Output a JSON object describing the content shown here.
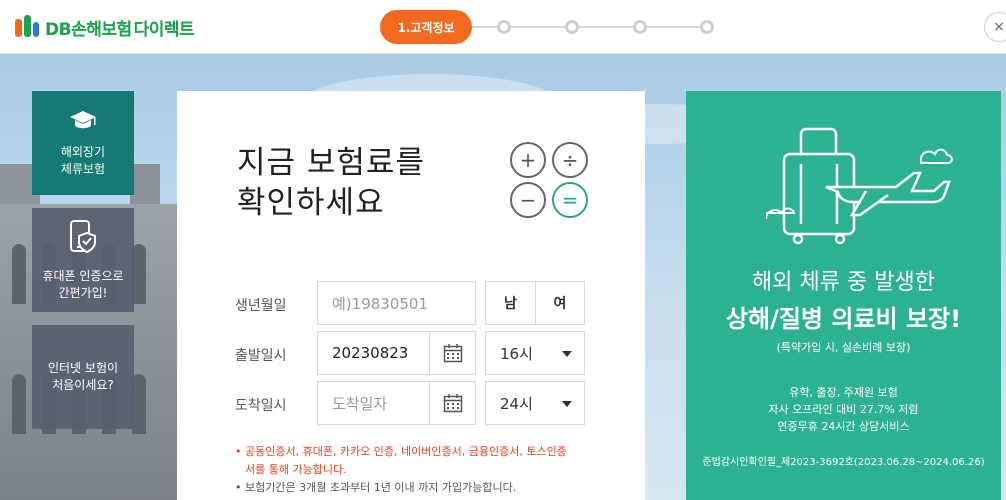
{
  "header": {
    "logo_text": "DB손해보험",
    "logo_sub": "다이렉트",
    "active_step": "1.고객정보",
    "close_label": "×"
  },
  "sidebar": {
    "items": [
      {
        "label_line1": "해외장기",
        "label_line2": "체류보험",
        "icon": "graduation-cap-icon"
      },
      {
        "label_line1": "휴대폰 인증으로",
        "label_line2": "간편가입!",
        "icon": "phone-shield-icon"
      },
      {
        "label_line1": "인터넷 보험이",
        "label_line2": "처음이세요?",
        "icon": "none"
      }
    ]
  },
  "form": {
    "title_line1": "지금 보험료를",
    "title_line2": "확인하세요",
    "calc_symbols": [
      "+",
      "÷",
      "−",
      "="
    ],
    "birth": {
      "label": "생년월일",
      "placeholder": "예)19830501",
      "gender_male": "남",
      "gender_female": "여"
    },
    "departure": {
      "label": "출발일시",
      "date_value": "20230823",
      "hour_value": "16시"
    },
    "arrival": {
      "label": "도착일시",
      "date_placeholder": "도착일자",
      "hour_value": "24시"
    },
    "notices": {
      "red_line1": "• 공동인증서, 휴대폰, 카카오 인증, 네이버인증서, 금융인증서, 토스인증",
      "red_line2": "서를 통해 가능합니다.",
      "gray_line": "• 보험기간은 3개월 초과부터 1년 이내 까지 가입가능합니다."
    }
  },
  "promo": {
    "head1": "해외 체류 중 발생한",
    "head2": "상해/질병 의료비 보장!",
    "sub": "(특약가입 시, 실손비례 보장)",
    "line1": "유학, 출장, 주재원 보험",
    "line2": "자사 오프라인 대비 27.7% 저렴",
    "line3": "연중무휴 24시간 상담서비스",
    "footer": "준법감시인확인필_제2023-3692호(2023.06.28~2024.06.26)"
  },
  "colors": {
    "brand_green": "#1aa34a",
    "step_orange": "#f26a1f",
    "promo_teal": "#2db193",
    "side_teal": "#157a74",
    "notice_red": "#e3411a"
  }
}
